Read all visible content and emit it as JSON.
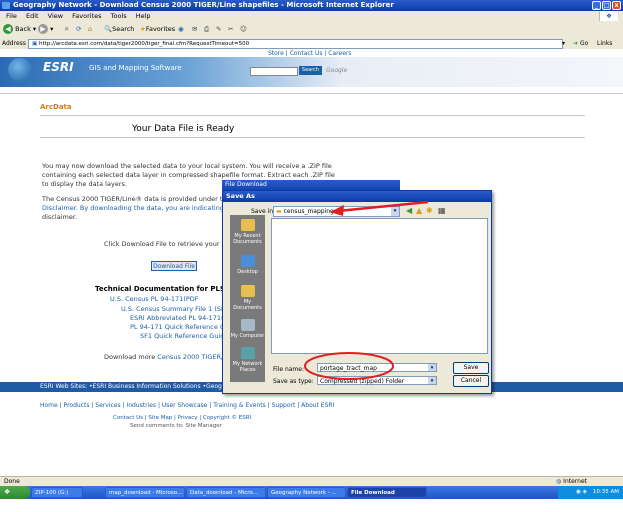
{
  "window": {
    "title": "Geography Network - Download Census 2000 TIGER/Line shapefiles - Microsoft Internet Explorer",
    "min": "_",
    "max": "□",
    "close": "x"
  },
  "menu": [
    "File",
    "Edit",
    "View",
    "Favorites",
    "Tools",
    "Help"
  ],
  "toolbar": {
    "back": "Back",
    "search": "Search",
    "favorites": "Favorites"
  },
  "address": {
    "label": "Address",
    "url": "http://arcdata.esri.com/data/tiger2000/tiger_final.cfm?RequestTimeout=500",
    "go": "Go",
    "links": "Links"
  },
  "site": {
    "topnav": "Store  |  Contact Us  |  Careers",
    "brand": "ESRI",
    "tagline": "GIS and Mapping Software",
    "search_button": "Search",
    "google": "Google",
    "section": "ArcData",
    "title": "Your Data File is Ready",
    "para1": [
      "You may now download the selected data to your local system. You will receive a .ZIP file",
      "containing each selected data layer in compressed shapefile format. Extract each .ZIP file",
      "to display the data layers."
    ],
    "para2": [
      "The Census 2000 TIGER/Line® data is provided under the",
      "Disclaimer. By downloading the data, you are indicating y",
      "disclaimer."
    ],
    "click_text": "Click Download File to retrieve your d",
    "download_button": "Download File",
    "docs_heading": "Technical Documentation for PL94-171",
    "doc_links": [
      "U.S. Census PL 94-171(PDF",
      "U.S. Census Summary File 1 (SF1",
      "ESRI Abbreviated PL 94-171(P",
      "PL 94-171 Quick Reference Gu",
      "SF1 Quick Reference Guide"
    ],
    "download_more": "Download more",
    "download_more_link": "Census 2000 TIGER/Li",
    "websites": "ESRI Web Sites:  •ESRI Business Information Solutions  •Geography",
    "footer_links": "Home | Products | Services | Industries | User Showcase | Training & Events | Support | About ESRI",
    "footer2": "Contact Us | Site Map | Privacy | Copyright © ESRI",
    "footer3": "Send comments to: Site Manager"
  },
  "file_download": {
    "title": "File Download"
  },
  "save_as": {
    "title": "Save As",
    "save_in_label": "Save in:",
    "save_in_value": "census_mapping",
    "places": [
      "My Recent Documents",
      "Desktop",
      "My Documents",
      "My Computer",
      "My Network Places"
    ],
    "file_name_label": "File name:",
    "file_name_value": "portage_tract_map",
    "save_type_label": "Save as type:",
    "save_type_value": "Compressed (zipped) Folder",
    "save_button": "Save",
    "cancel_button": "Cancel"
  },
  "status": {
    "left": "Done",
    "right": "Internet"
  },
  "taskbar": {
    "start": "Start",
    "items": [
      "ZIP-100 (G:)",
      "map_download - Microso...",
      "Data_download - Micro...",
      "Geography Network - ...",
      "File Download"
    ],
    "clock": "10:35 AM"
  }
}
